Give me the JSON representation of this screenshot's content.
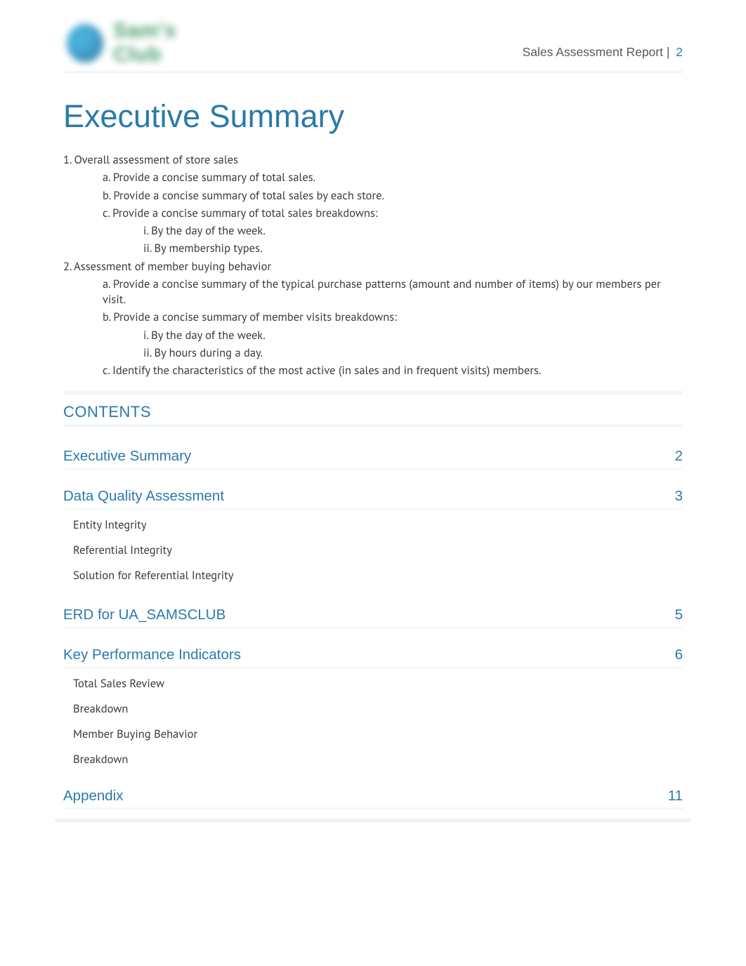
{
  "header": {
    "logo_text": "Sam's Club",
    "doc_title": "Sales Assessment Report",
    "separator": " | ",
    "page_number": "2"
  },
  "title": "Executive Summary",
  "outline": {
    "item1": "1. Overall assessment of store sales",
    "item1a": "a. Provide a concise summary of total sales.",
    "item1b": "b. Provide a concise summary of total sales by each store.",
    "item1c": "c. Provide a concise summary of total sales breakdowns:",
    "item1ci": "i. By the day of the week.",
    "item1cii": "ii. By membership types.",
    "item2": "2. Assessment of member buying behavior",
    "item2a": "a. Provide a concise summary of the typical purchase patterns (amount and number of items) by our members per visit.",
    "item2b": "b. Provide a concise summary of member visits breakdowns:",
    "item2bi": "i. By the day of the week.",
    "item2bii": "ii. By hours during a day.",
    "item2c": "c. Identify the characteristics of the most active (in sales and in frequent visits) members."
  },
  "contents": {
    "heading": "CONTENTS",
    "sections": [
      {
        "title": "Executive Summary",
        "page": "2",
        "subs": []
      },
      {
        "title": "Data Quality Assessment",
        "page": "3",
        "subs": [
          "Entity Integrity",
          "Referential Integrity",
          "Solution for Referential Integrity"
        ]
      },
      {
        "title": "ERD for UA_SAMSCLUB",
        "page": "5",
        "subs": []
      },
      {
        "title": "Key Performance Indicators",
        "page": "6",
        "subs": [
          "Total Sales Review",
          "Breakdown",
          "Member Buying Behavior",
          "Breakdown"
        ]
      },
      {
        "title": "Appendix",
        "page": "11",
        "subs": []
      }
    ]
  }
}
